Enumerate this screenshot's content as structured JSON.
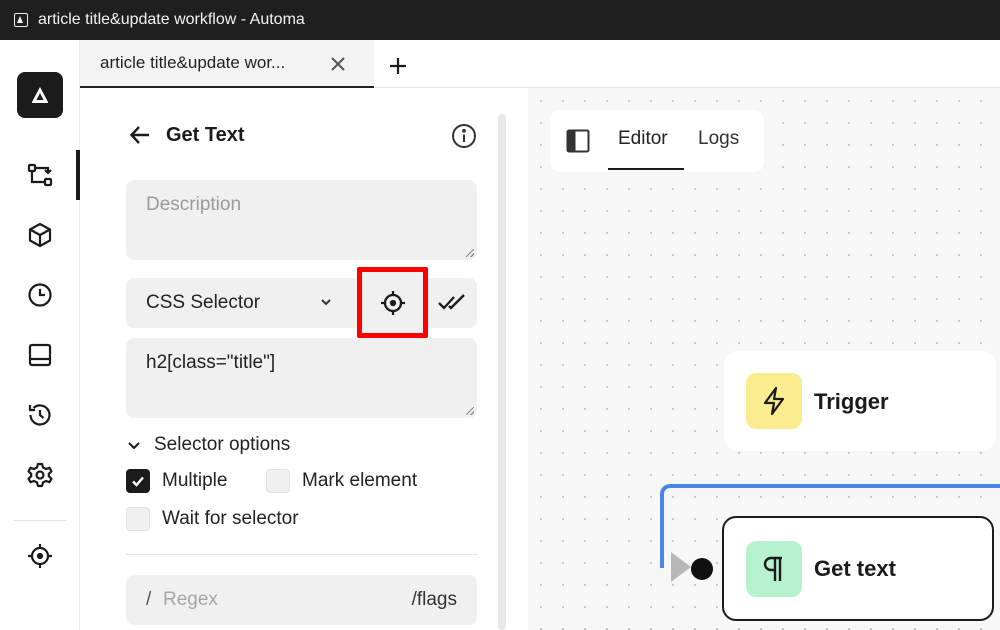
{
  "window": {
    "title": "article title&update workflow - Automa"
  },
  "tabs": [
    {
      "label": "article title&update wor..."
    }
  ],
  "rail": {
    "items": [
      {
        "icon": "workflow-icon",
        "active": true
      },
      {
        "icon": "package-icon"
      },
      {
        "icon": "clock-icon"
      },
      {
        "icon": "storage-icon"
      },
      {
        "icon": "history-icon"
      },
      {
        "icon": "settings-icon"
      },
      {
        "icon": "element-picker-icon"
      }
    ]
  },
  "panel": {
    "title": "Get Text",
    "description_placeholder": "Description",
    "selector_type": "CSS Selector",
    "selector_value": "h2[class=\"title\"]",
    "selector_options_label": "Selector options",
    "options": {
      "multiple": {
        "label": "Multiple",
        "checked": true
      },
      "mark_element": {
        "label": "Mark element",
        "checked": false
      },
      "wait_for_selector": {
        "label": "Wait for selector",
        "checked": false
      }
    },
    "regex": {
      "slash": "/",
      "placeholder": "Regex",
      "flags": "/flags"
    }
  },
  "canvas": {
    "tabs": {
      "editor": "Editor",
      "logs": "Logs"
    },
    "nodes": {
      "trigger": {
        "title": "Trigger",
        "color": "#fbec8f"
      },
      "get_text": {
        "title": "Get text",
        "color": "#b7f2cf"
      }
    },
    "edge_color": "#4a86e8"
  },
  "colors": {
    "highlight": "#ff0000",
    "dark": "#1b1b1b"
  }
}
